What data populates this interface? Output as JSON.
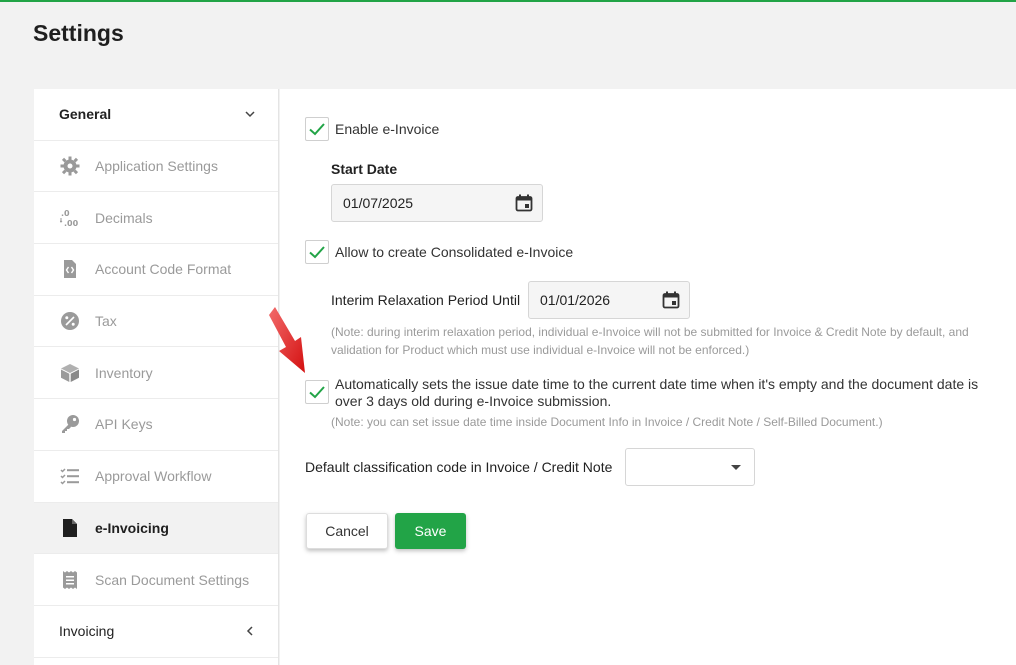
{
  "page": {
    "title": "Settings",
    "accent": "#22a447"
  },
  "sidebar": {
    "items": [
      {
        "label": "General",
        "icon": "chevron-down-icon"
      },
      {
        "label": "Application Settings",
        "icon": "gear-icon"
      },
      {
        "label": "Decimals",
        "icon": "decimals-icon"
      },
      {
        "label": "Account Code Format",
        "icon": "code-file-icon"
      },
      {
        "label": "Tax",
        "icon": "percent-icon"
      },
      {
        "label": "Inventory",
        "icon": "box-icon"
      },
      {
        "label": "API Keys",
        "icon": "key-icon"
      },
      {
        "label": "Approval Workflow",
        "icon": "checklist-icon"
      },
      {
        "label": "e-Invoicing",
        "icon": "document-icon"
      },
      {
        "label": "Scan Document Settings",
        "icon": "receipt-icon"
      },
      {
        "label": "Invoicing",
        "icon": "chevron-left-icon"
      }
    ],
    "active_label": "e-Invoicing"
  },
  "form": {
    "enable_einvoice": {
      "label": "Enable e-Invoice",
      "checked": true
    },
    "start_date": {
      "label": "Start Date",
      "value": "01/07/2025"
    },
    "consolidated": {
      "label": "Allow to create Consolidated e-Invoice",
      "checked": true
    },
    "interim": {
      "label": "Interim Relaxation Period Until",
      "value": "01/01/2026",
      "note_line1": "(Note: during interim relaxation period, individual e-Invoice will not be submitted for Invoice & Credit Note by default, and",
      "note_line2": "validation for Product which must use individual e-Invoice will not be enforced.)"
    },
    "auto_issue": {
      "label_line1": "Automatically sets the issue date time to the current date time when it's empty and the document date is",
      "label_line2": "over 3 days old during e-Invoice submission.",
      "checked": true,
      "note": "(Note: you can set issue date time inside Document Info in Invoice / Credit Note / Self-Billed Document.)"
    },
    "classification": {
      "label": "Default classification code in Invoice / Credit Note",
      "value": ""
    },
    "cancel_label": "Cancel",
    "save_label": "Save"
  }
}
